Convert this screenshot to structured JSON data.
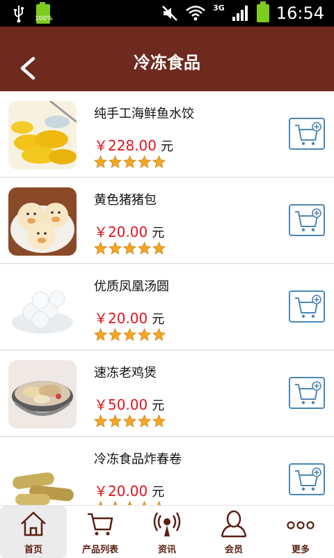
{
  "status_bar": {
    "time": "16:54",
    "battery_left": "100%",
    "network": "3G",
    "icons": [
      "usb-icon",
      "battery-icon",
      "mute-icon",
      "wifi-icon",
      "signal-icon",
      "battery-icon"
    ]
  },
  "header": {
    "title": "冷冻食品",
    "back_icon": "back-arrow-icon"
  },
  "products": [
    {
      "name": "纯手工海鲜鱼水饺",
      "price": "￥228.00",
      "unit": "元",
      "rating": 5
    },
    {
      "name": "黄色猪猪包",
      "price": "￥20.00",
      "unit": "元",
      "rating": 5
    },
    {
      "name": "优质凤凰汤圆",
      "price": "￥20.00",
      "unit": "元",
      "rating": 5
    },
    {
      "name": "速冻老鸡煲",
      "price": "￥50.00",
      "unit": "元",
      "rating": 5
    },
    {
      "name": "冷冻食品炸春卷",
      "price": "￥20.00",
      "unit": "元",
      "rating": 5
    }
  ],
  "bottom_nav": [
    {
      "label": "首页",
      "icon": "home-icon",
      "active": true
    },
    {
      "label": "产品列表",
      "icon": "cart-icon",
      "active": false
    },
    {
      "label": "资讯",
      "icon": "broadcast-icon",
      "active": false
    },
    {
      "label": "会员",
      "icon": "user-icon",
      "active": false
    },
    {
      "label": "更多",
      "icon": "more-icon",
      "active": false
    }
  ],
  "colors": {
    "header": "#6e2a1e",
    "price": "#e0131d",
    "cart_border": "#4a86b8",
    "nav_label": "#5a1f14",
    "star": "#f5a623"
  }
}
